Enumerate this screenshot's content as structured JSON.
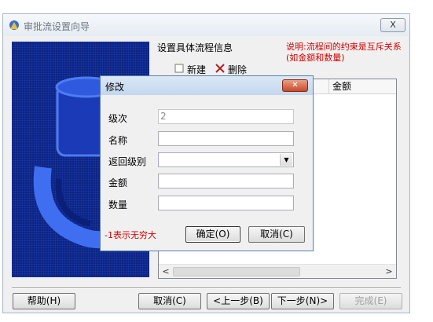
{
  "window": {
    "title": "审批流设置向导",
    "close_label": "X"
  },
  "wizard": {
    "heading": "设置具体流程信息",
    "note": "说明:流程间的约束是互斥关系(如金额和数量)",
    "toolbar": {
      "new_label": "新建",
      "delete_label": "删除"
    },
    "list": {
      "columns": [
        "金额"
      ]
    }
  },
  "buttons": {
    "help": "帮助(H)",
    "cancel": "取消(C)",
    "prev": "<上一步(B)",
    "next": "下一步(N)>",
    "finish": "完成(E)"
  },
  "modal": {
    "title": "修改",
    "fields": {
      "level_label": "级次",
      "level_value": "2",
      "name_label": "名称",
      "name_value": "",
      "return_label": "返回级别",
      "return_value": "",
      "amount_label": "金额",
      "amount_value": "",
      "quantity_label": "数量",
      "quantity_value": ""
    },
    "hint": "-1表示无穷大",
    "ok": "确定(O)",
    "cancel": "取消(C)"
  },
  "colors": {
    "accent": "#0a1f7a",
    "warning_text": "#d40000"
  }
}
